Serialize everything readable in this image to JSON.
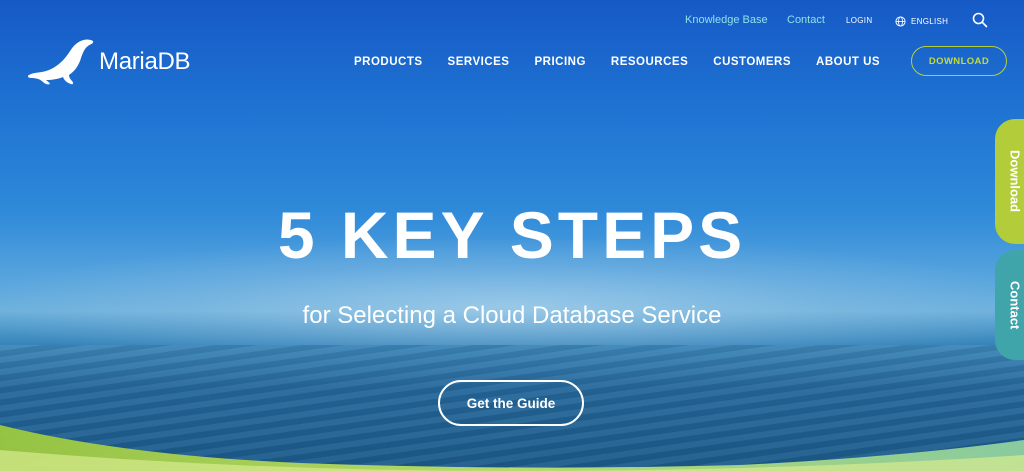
{
  "topbar": {
    "knowledge_base": "Knowledge Base",
    "contact": "Contact",
    "login": "LOGIN",
    "language": "ENGLISH"
  },
  "logo": {
    "text": "MariaDB"
  },
  "nav": {
    "items": [
      "PRODUCTS",
      "SERVICES",
      "PRICING",
      "RESOURCES",
      "CUSTOMERS",
      "ABOUT US"
    ],
    "download": "DOWNLOAD"
  },
  "hero": {
    "title": "5 KEY STEPS",
    "subtitle": "for Selecting a Cloud Database Service",
    "cta": "Get the Guide"
  },
  "side_tabs": {
    "download": "Download",
    "contact": "Contact"
  },
  "colors": {
    "accent_green": "#b3cc3a",
    "accent_teal": "#3fa5aa",
    "link_cyan": "#8fe0e8"
  }
}
